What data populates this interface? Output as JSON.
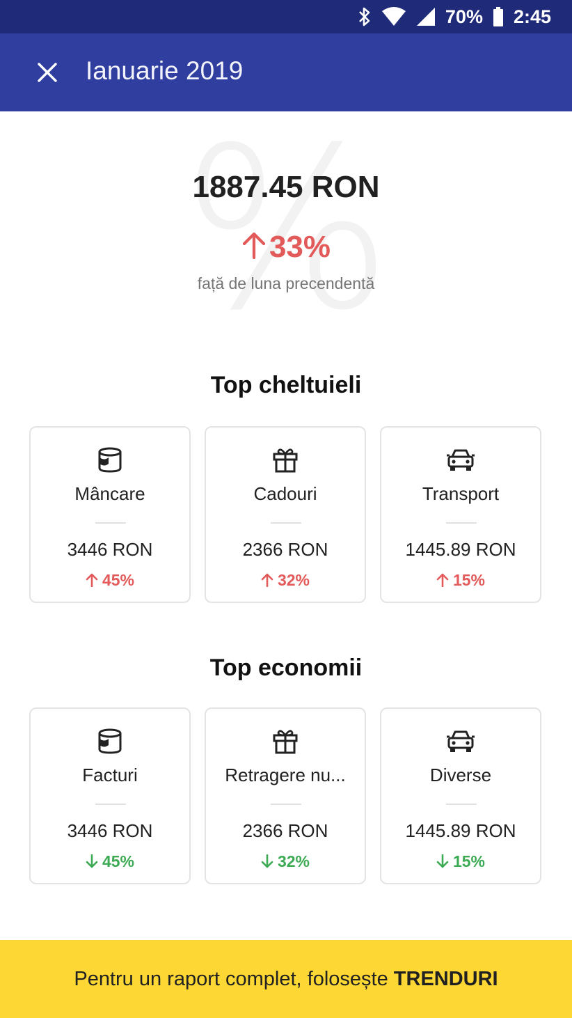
{
  "status_bar": {
    "battery": "70%",
    "time": "2:45",
    "icons": [
      "bluetooth-icon",
      "wifi-icon",
      "signal-icon",
      "battery-icon"
    ]
  },
  "app_bar": {
    "title": "Ianuarie 2019",
    "close_icon": "close-icon",
    "color": "#303f9f"
  },
  "summary": {
    "total": "1887.45 RON",
    "change": "33%",
    "change_direction": "up",
    "compare_text": "față de luna precendentă",
    "watermark": "%"
  },
  "top_expenses": {
    "title": "Top cheltuieli",
    "items": [
      {
        "icon": "food-can-icon",
        "name": "Mâncare",
        "amount": "3446 RON",
        "pct": "45%",
        "direction": "up"
      },
      {
        "icon": "gift-icon",
        "name": "Cadouri",
        "amount": "2366 RON",
        "pct": "32%",
        "direction": "up"
      },
      {
        "icon": "car-icon",
        "name": "Transport",
        "amount": "1445.89 RON",
        "pct": "15%",
        "direction": "up"
      }
    ]
  },
  "top_savings": {
    "title": "Top economii",
    "items": [
      {
        "icon": "food-can-icon",
        "name": "Facturi",
        "amount": "3446 RON",
        "pct": "45%",
        "direction": "down"
      },
      {
        "icon": "gift-icon",
        "name": "Retragere nu...",
        "amount": "2366 RON",
        "pct": "32%",
        "direction": "down"
      },
      {
        "icon": "car-icon",
        "name": "Diverse",
        "amount": "1445.89 RON",
        "pct": "15%",
        "direction": "down"
      }
    ]
  },
  "footer": {
    "text": "Pentru un raport complet, folosește ",
    "link": "TRENDURI",
    "color": "#fdd835"
  },
  "colors": {
    "up": "#e35a5a",
    "down": "#3daa54",
    "status_bar": "#1f2a78"
  }
}
